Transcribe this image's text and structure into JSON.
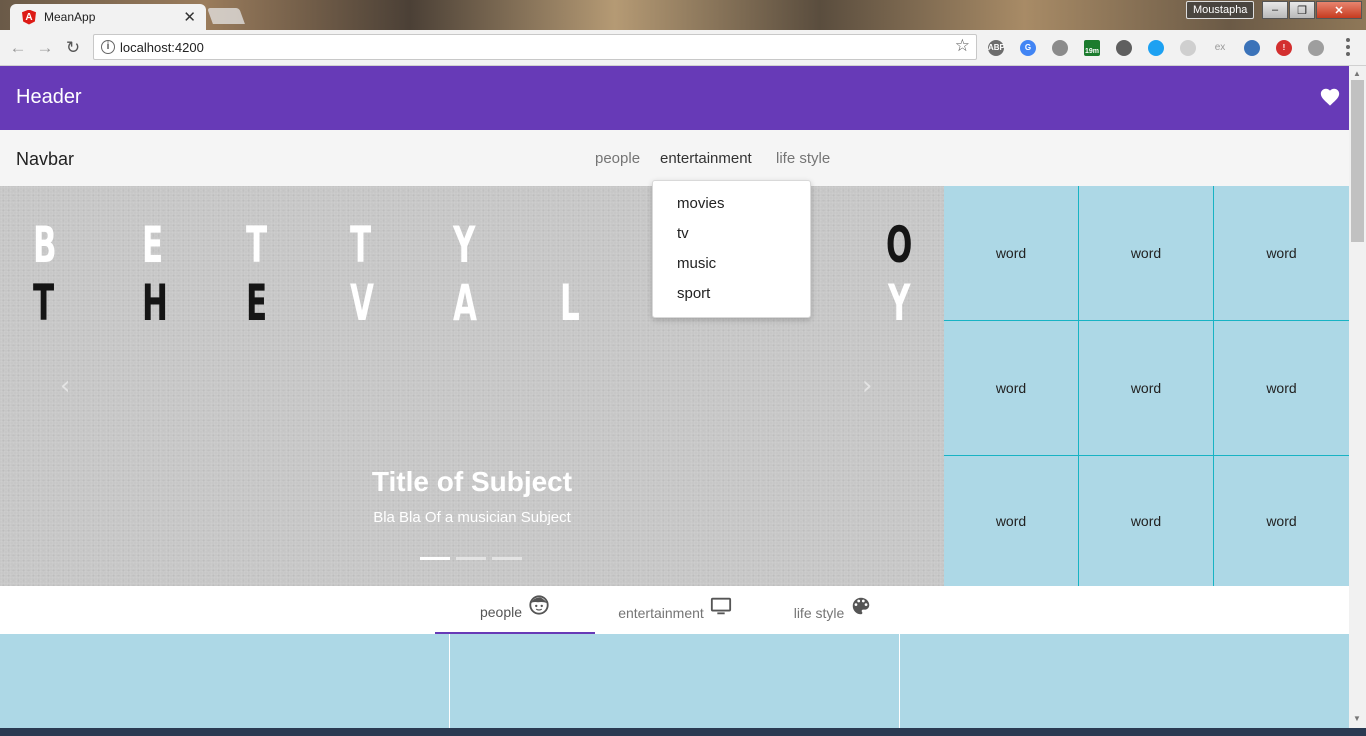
{
  "browser": {
    "tab_title": "MeanApp",
    "tab_favicon": "A",
    "tab_close": "✕",
    "url": "localhost:4200",
    "user": "Moustapha",
    "extensions": [
      {
        "name": "adblock-icon",
        "label": "ABP",
        "color": "#6d6d6d"
      },
      {
        "name": "translate-icon",
        "label": "G",
        "color": "#4285f4"
      },
      {
        "name": "photo-extension-icon",
        "label": "",
        "color": "#8b8b8b"
      },
      {
        "name": "badge-extension-icon",
        "label": "19m",
        "color": "#1c7c2e"
      },
      {
        "name": "lighthouse-icon",
        "label": "",
        "color": "#5f5f5f"
      },
      {
        "name": "window-extension-icon",
        "label": "",
        "color": "#1da1f2"
      },
      {
        "name": "feather-icon",
        "label": "",
        "color": "#cfcfcf"
      },
      {
        "name": "ex-extension-icon",
        "label": "ex",
        "color": "#cccccc"
      },
      {
        "name": "gear-extension-icon",
        "label": "",
        "color": "#3b73b9"
      },
      {
        "name": "alert-extension-icon",
        "label": "!",
        "color": "#d32f2f"
      },
      {
        "name": "shield-extension-icon",
        "label": "",
        "color": "#9e9e9e"
      }
    ]
  },
  "header": {
    "title": "Header"
  },
  "navbar": {
    "title": "Navbar",
    "links": [
      "people",
      "entertainment",
      "life style"
    ],
    "active": "entertainment"
  },
  "dropdown": {
    "items": [
      "movies",
      "tv",
      "music",
      "sport"
    ]
  },
  "carousel": {
    "row1": [
      "B",
      "E",
      "T",
      "T",
      "Y",
      "O"
    ],
    "row2": [
      "T",
      "H",
      "E",
      "V",
      "A",
      "L",
      "Y"
    ],
    "title": "Title of Subject",
    "subtitle": "Bla Bla Of a musician Subject",
    "prev": "‹",
    "next": "›",
    "slides": 3,
    "active_slide": 1
  },
  "grid": {
    "cells": [
      "word",
      "word",
      "word",
      "word",
      "word",
      "word",
      "word",
      "word",
      "word"
    ]
  },
  "tabs": [
    {
      "label": "people",
      "icon": "face-icon",
      "active": true
    },
    {
      "label": "entertainment",
      "icon": "tv-icon",
      "active": false
    },
    {
      "label": "life style",
      "icon": "palette-icon",
      "active": false
    }
  ],
  "colors": {
    "primary": "#673ab7",
    "grid_bg": "#add8e6",
    "grid_line": "#17b3c4",
    "carousel_bg": "#c7c7c7"
  }
}
